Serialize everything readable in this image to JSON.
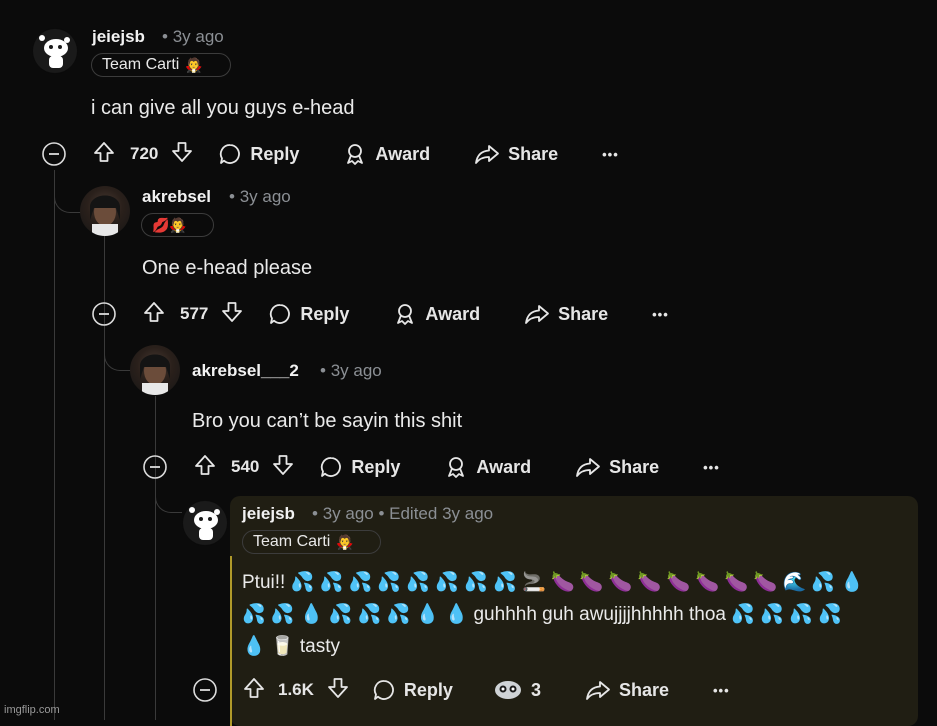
{
  "comments": [
    {
      "username": "jeiejsb",
      "time": "3y ago",
      "flair": "Team Carti",
      "flair_emoji": "🧛",
      "body": "i can give all you guys e-head",
      "votes": "720",
      "reply_label": "Reply",
      "award_label": "Award",
      "share_label": "Share",
      "more_label": "•••"
    },
    {
      "username": "akrebsel",
      "time": "3y ago",
      "flair_emoji": "💋🧛",
      "body": "One e-head please",
      "votes": "577",
      "reply_label": "Reply",
      "award_label": "Award",
      "share_label": "Share",
      "more_label": "•••"
    },
    {
      "username": "akrebsel___2",
      "time": "3y ago",
      "body": "Bro you can’t be sayin this shit",
      "votes": "540",
      "reply_label": "Reply",
      "award_label": "Award",
      "share_label": "Share",
      "more_label": "•••"
    },
    {
      "username": "jeiejsb",
      "time": "3y ago",
      "edited": "Edited 3y ago",
      "flair": "Team Carti",
      "flair_emoji": "🧛",
      "body_line1": "Ptui!! 💦 💦 💦 💦 💦 💦 💦 💦 🚬 🍆 🍆 🍆 🍆 🍆 🍆 🍆 🍆 🌊 💦 💧",
      "body_line2": "💦 💦 💧 💦 💦 💦 💧 💧 guhhhh guh awujjjjhhhhh thoa 💦 💦 💦 💦",
      "body_line3": "💧 🥛 tasty",
      "votes": "1.6K",
      "reply_label": "Reply",
      "award_count": "3",
      "share_label": "Share",
      "more_label": "•••"
    }
  ],
  "watermark": "imgflip.com"
}
